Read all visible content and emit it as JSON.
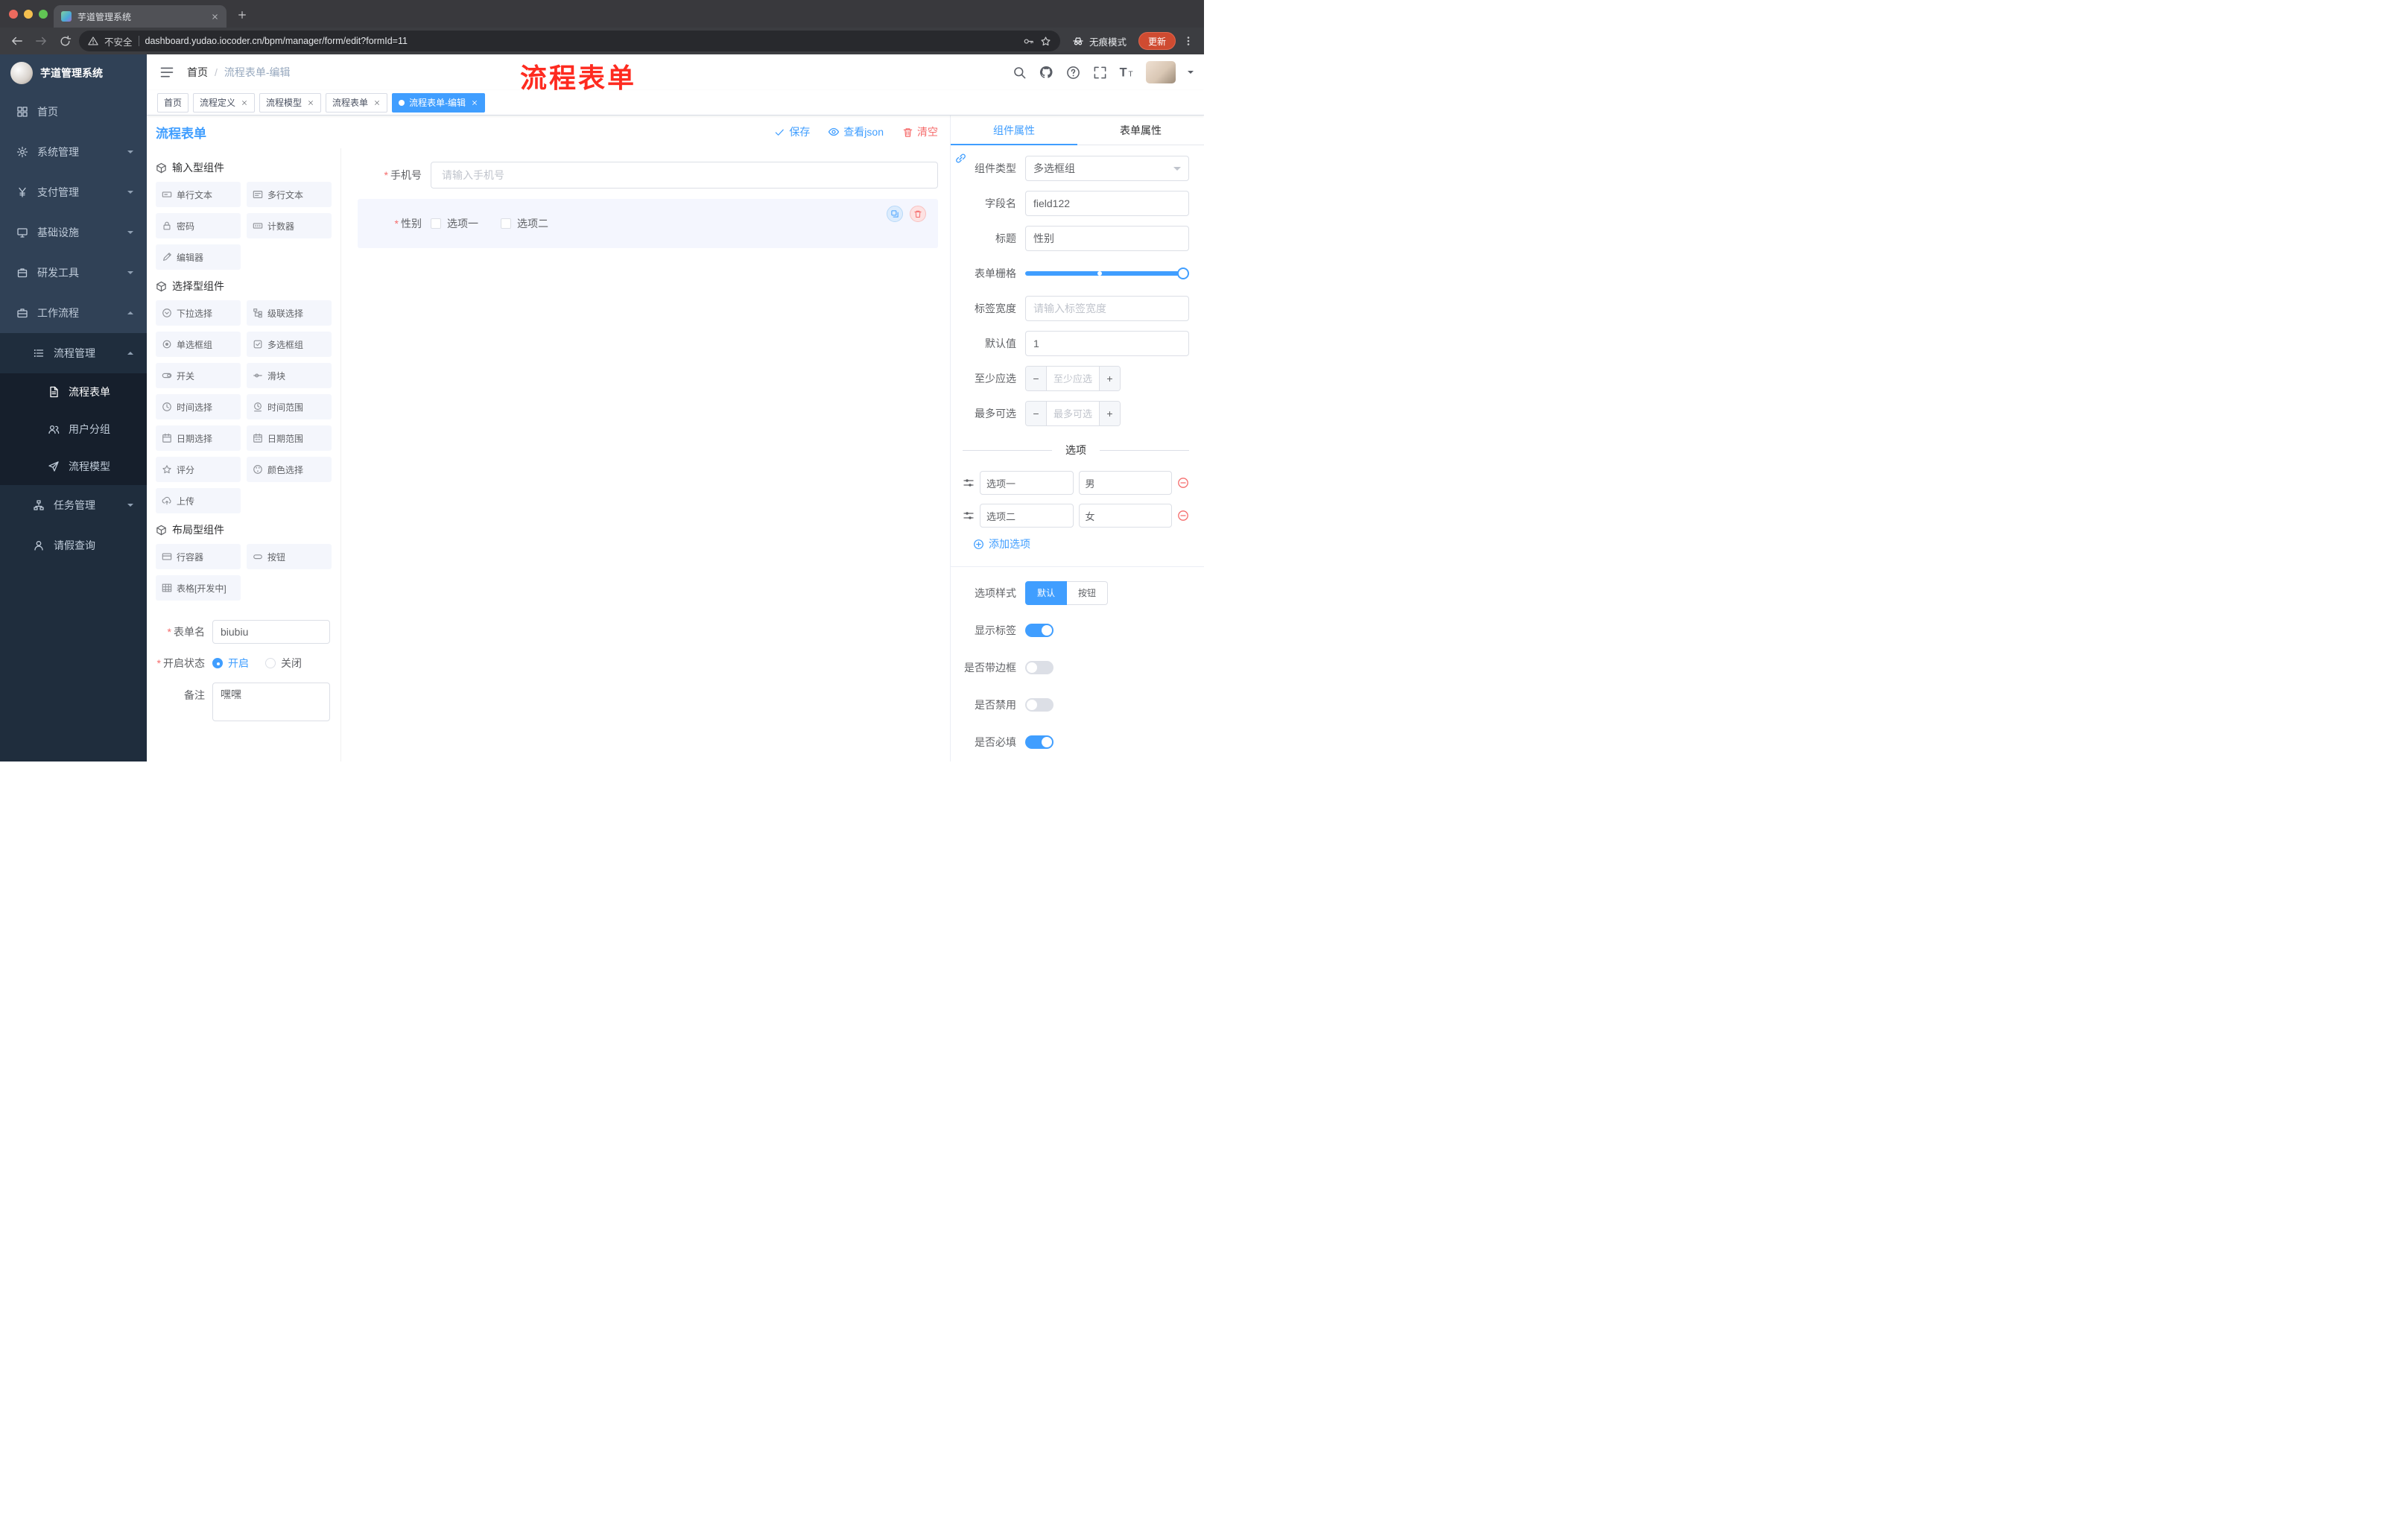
{
  "colors": {
    "primary": "#409EFF",
    "danger": "#F56C6C",
    "sidebar_bg": "#304156",
    "sidebar_sub_bg": "#1F2D3D",
    "annotation": "#FE2B20"
  },
  "glyphs": {
    "breadcrumb_sep": "/",
    "minus": "−",
    "plus": "+"
  },
  "browser": {
    "tab_title": "芋道管理系统",
    "security_label": "不安全",
    "url": "dashboard.yudao.iocoder.cn/bpm/manager/form/edit?formId=11",
    "incognito_label": "无痕模式",
    "update_label": "更新"
  },
  "annotation": {
    "text": "流程表单"
  },
  "sidebar": {
    "logo_title": "芋道管理系统",
    "items": [
      {
        "label": "首页"
      },
      {
        "label": "系统管理"
      },
      {
        "label": "支付管理"
      },
      {
        "label": "基础设施"
      },
      {
        "label": "研发工具"
      },
      {
        "label": "工作流程"
      },
      {
        "label": "流程管理"
      },
      {
        "label": "流程表单"
      },
      {
        "label": "用户分组"
      },
      {
        "label": "流程模型"
      },
      {
        "label": "任务管理"
      },
      {
        "label": "请假查询"
      }
    ]
  },
  "navbar": {
    "breadcrumb_home": "首页",
    "breadcrumb_current": "流程表单-编辑"
  },
  "tags": {
    "t0": "首页",
    "t1": "流程定义",
    "t2": "流程模型",
    "t3": "流程表单",
    "t4": "流程表单-编辑"
  },
  "editor": {
    "title": "流程表单",
    "save": "保存",
    "view_json": "查看json",
    "clear": "清空",
    "sections": {
      "inputs_title": "输入型组件",
      "select_title": "选择型组件",
      "layout_title": "布局型组件"
    },
    "components": {
      "c_single": "单行文本",
      "c_multi": "多行文本",
      "c_password": "密码",
      "c_counter": "计数器",
      "c_editor": "编辑器",
      "c_select": "下拉选择",
      "c_cascader": "级联选择",
      "c_radio": "单选框组",
      "c_checkbox": "多选框组",
      "c_switch": "开关",
      "c_slider": "滑块",
      "c_time": "时间选择",
      "c_timerange": "时间范围",
      "c_date": "日期选择",
      "c_daterange": "日期范围",
      "c_rate": "评分",
      "c_color": "颜色选择",
      "c_upload": "上传",
      "c_row": "行容器",
      "c_button": "按钮",
      "c_table": "表格[开发中]"
    },
    "meta": {
      "name_label": "表单名",
      "name_value": "biubiu",
      "status_label": "开启状态",
      "status_on": "开启",
      "status_off": "关闭",
      "remark_label": "备注",
      "remark_value": "嘿嘿"
    },
    "canvas": {
      "phone_label": "手机号",
      "phone_placeholder": "请输入手机号",
      "gender_label": "性别",
      "gender_opt1": "选项一",
      "gender_opt2": "选项二"
    }
  },
  "props": {
    "tab_component": "组件属性",
    "tab_form": "表单属性",
    "rows": {
      "type_label": "组件类型",
      "type_value": "多选框组",
      "field_label": "字段名",
      "field_value": "field122",
      "title_label": "标题",
      "title_value": "性别",
      "grid_label": "表单栅格",
      "width_label": "标签宽度",
      "width_placeholder": "请输入标签宽度",
      "default_label": "默认值",
      "default_value": "1",
      "min_label": "至少应选",
      "min_placeholder": "至少应选",
      "max_label": "最多可选",
      "max_placeholder": "最多可选"
    },
    "options_title": "选项",
    "opt1_label": "选项一",
    "opt1_value": "男",
    "opt2_label": "选项二",
    "opt2_value": "女",
    "add_option": "添加选项",
    "style_label": "选项样式",
    "style_default": "默认",
    "style_button": "按钮",
    "sw_show": "显示标签",
    "sw_border": "是否带边框",
    "sw_disabled": "是否禁用",
    "sw_required": "是否必填"
  }
}
